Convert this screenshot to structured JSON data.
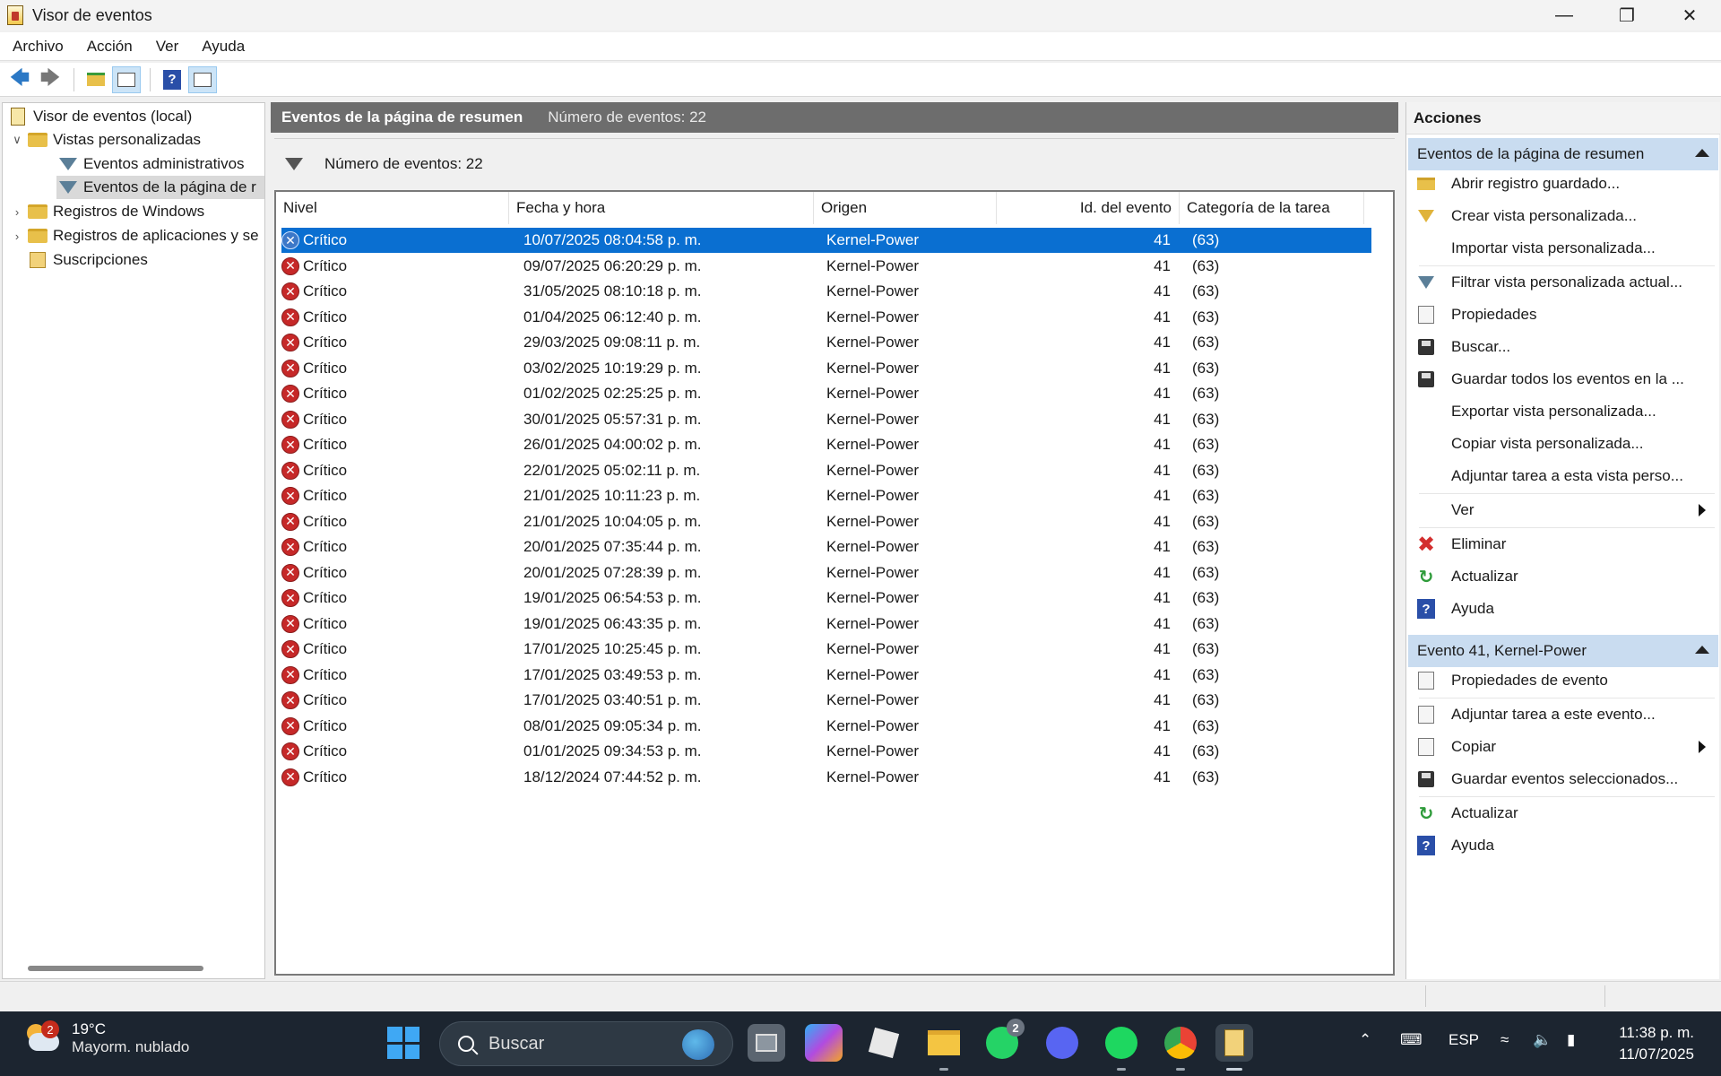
{
  "window": {
    "title": "Visor de eventos"
  },
  "menu": [
    "Archivo",
    "Acción",
    "Ver",
    "Ayuda"
  ],
  "tree": {
    "items": [
      {
        "label": "Visor de eventos (local)",
        "icon": "event-viewer-icon"
      },
      {
        "label": "Vistas personalizadas",
        "icon": "folder-icon",
        "expanded": true
      },
      {
        "label": "Eventos administrativos",
        "icon": "filter-icon"
      },
      {
        "label": "Eventos de la página de r",
        "icon": "filter-icon",
        "selected": true
      },
      {
        "label": "Registros de Windows",
        "icon": "folder-icon",
        "expanded": false
      },
      {
        "label": "Registros de aplicaciones y se",
        "icon": "folder-icon",
        "expanded": false
      },
      {
        "label": "Suscripciones",
        "icon": "subscriptions-icon"
      }
    ]
  },
  "center": {
    "header_title": "Eventos de la página de resumen",
    "header_count": "Número de eventos: 22",
    "filter_text": "Número de eventos: 22",
    "columns": [
      "Nivel",
      "Fecha y hora",
      "Origen",
      "Id. del evento",
      "Categoría de la tarea"
    ],
    "rows": [
      [
        "Crítico",
        "10/07/2025 08:04:58 p. m.",
        "Kernel-Power",
        "41",
        "(63)"
      ],
      [
        "Crítico",
        "09/07/2025 06:20:29 p. m.",
        "Kernel-Power",
        "41",
        "(63)"
      ],
      [
        "Crítico",
        "31/05/2025 08:10:18 p. m.",
        "Kernel-Power",
        "41",
        "(63)"
      ],
      [
        "Crítico",
        "01/04/2025 06:12:40 p. m.",
        "Kernel-Power",
        "41",
        "(63)"
      ],
      [
        "Crítico",
        "29/03/2025 09:08:11 p. m.",
        "Kernel-Power",
        "41",
        "(63)"
      ],
      [
        "Crítico",
        "03/02/2025 10:19:29 p. m.",
        "Kernel-Power",
        "41",
        "(63)"
      ],
      [
        "Crítico",
        "01/02/2025 02:25:25 p. m.",
        "Kernel-Power",
        "41",
        "(63)"
      ],
      [
        "Crítico",
        "30/01/2025 05:57:31 p. m.",
        "Kernel-Power",
        "41",
        "(63)"
      ],
      [
        "Crítico",
        "26/01/2025 04:00:02 p. m.",
        "Kernel-Power",
        "41",
        "(63)"
      ],
      [
        "Crítico",
        "22/01/2025 05:02:11 p. m.",
        "Kernel-Power",
        "41",
        "(63)"
      ],
      [
        "Crítico",
        "21/01/2025 10:11:23 p. m.",
        "Kernel-Power",
        "41",
        "(63)"
      ],
      [
        "Crítico",
        "21/01/2025 10:04:05 p. m.",
        "Kernel-Power",
        "41",
        "(63)"
      ],
      [
        "Crítico",
        "20/01/2025 07:35:44 p. m.",
        "Kernel-Power",
        "41",
        "(63)"
      ],
      [
        "Crítico",
        "20/01/2025 07:28:39 p. m.",
        "Kernel-Power",
        "41",
        "(63)"
      ],
      [
        "Crítico",
        "19/01/2025 06:54:53 p. m.",
        "Kernel-Power",
        "41",
        "(63)"
      ],
      [
        "Crítico",
        "19/01/2025 06:43:35 p. m.",
        "Kernel-Power",
        "41",
        "(63)"
      ],
      [
        "Crítico",
        "17/01/2025 10:25:45 p. m.",
        "Kernel-Power",
        "41",
        "(63)"
      ],
      [
        "Crítico",
        "17/01/2025 03:49:53 p. m.",
        "Kernel-Power",
        "41",
        "(63)"
      ],
      [
        "Crítico",
        "17/01/2025 03:40:51 p. m.",
        "Kernel-Power",
        "41",
        "(63)"
      ],
      [
        "Crítico",
        "08/01/2025 09:05:34 p. m.",
        "Kernel-Power",
        "41",
        "(63)"
      ],
      [
        "Crítico",
        "01/01/2025 09:34:53 p. m.",
        "Kernel-Power",
        "41",
        "(63)"
      ],
      [
        "Crítico",
        "18/12/2024 07:44:52 p. m.",
        "Kernel-Power",
        "41",
        "(63)"
      ]
    ],
    "selected_row": 0
  },
  "actions": {
    "title": "Acciones",
    "section1": {
      "title": "Eventos de la página de resumen",
      "items": [
        {
          "label": "Abrir registro guardado...",
          "icon": "open-folder-icon"
        },
        {
          "label": "Crear vista personalizada...",
          "icon": "create-filter-icon"
        },
        {
          "label": "Importar vista personalizada...",
          "icon": ""
        },
        {
          "label": "Filtrar vista personalizada actual...",
          "icon": "filter-icon"
        },
        {
          "label": "Propiedades",
          "icon": "properties-icon"
        },
        {
          "label": "Buscar...",
          "icon": "binoculars-icon"
        },
        {
          "label": "Guardar todos los eventos en la ...",
          "icon": "save-icon"
        },
        {
          "label": "Exportar vista personalizada...",
          "icon": ""
        },
        {
          "label": "Copiar vista personalizada...",
          "icon": ""
        },
        {
          "label": "Adjuntar tarea a esta vista perso...",
          "icon": ""
        },
        {
          "label": "Ver",
          "icon": "",
          "submenu": true
        },
        {
          "label": "Eliminar",
          "icon": "delete-icon"
        },
        {
          "label": "Actualizar",
          "icon": "refresh-icon"
        },
        {
          "label": "Ayuda",
          "icon": "help-icon"
        }
      ]
    },
    "section2": {
      "title": "Evento 41, Kernel-Power",
      "items": [
        {
          "label": "Propiedades de evento",
          "icon": "properties-icon"
        },
        {
          "label": "Adjuntar tarea a este evento...",
          "icon": "task-icon"
        },
        {
          "label": "Copiar",
          "icon": "copy-icon",
          "submenu": true
        },
        {
          "label": "Guardar eventos seleccionados...",
          "icon": "save-icon"
        },
        {
          "label": "Actualizar",
          "icon": "refresh-icon"
        },
        {
          "label": "Ayuda",
          "icon": "help-icon"
        }
      ]
    }
  },
  "taskbar": {
    "weather_temp": "19°C",
    "weather_desc": "Mayorm. nublado",
    "weather_badge": "2",
    "search_placeholder": "Buscar",
    "whatsapp_badge": "2",
    "language": "ESP",
    "time": "11:38 p. m.",
    "date": "11/07/2025"
  },
  "colors": {
    "selection": "#0a6fd1",
    "section_header": "#c9dcf0",
    "critical": "#c62828",
    "taskbar": "#1c2530"
  }
}
